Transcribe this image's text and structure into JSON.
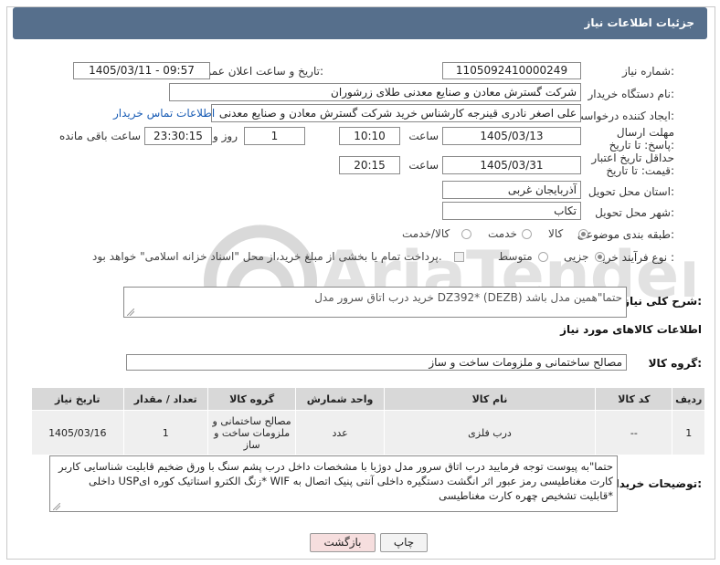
{
  "title": "جزئیات اطلاعات نیاز",
  "fields": {
    "need_number_label": "شماره نیاز:",
    "need_number": "1105092410000249",
    "announce_label": "تاریخ و ساعت اعلان عمومی:",
    "announce_value": "1405/03/11 - 09:57",
    "buyer_org_label": "نام دستگاه خریدار:",
    "buyer_org": "شرکت گسترش معادن و صنایع معدنی طلای زرشوران",
    "creator_label": "ایجاد کننده درخواست:",
    "creator": "علی اصغر نادری قینرجه کارشناس خرید  شرکت گسترش معادن و صنایع معدنی",
    "contact_link": "اطلاعات تماس خریدار",
    "reply_deadline_label": "مهلت ارسال پاسخ: تا تاریخ:",
    "reply_date": "1405/03/13",
    "time_label": "ساعت",
    "reply_time": "10:10",
    "days_value": "1",
    "day_and_label": "روز و",
    "remaining_time": "23:30:15",
    "remaining_label": "ساعت باقی مانده",
    "price_deadline_label": "حداقل تاریخ اعتبار قیمت: تا تاریخ:",
    "price_date": "1405/03/31",
    "price_time_label": "ساعت",
    "price_time": "20:15",
    "province_label": "استان محل تحویل:",
    "province": "آذربایجان غربی",
    "city_label": "شهر محل تحویل:",
    "city": "تکاب",
    "category_label": "طبقه بندی موضوعی:",
    "category_options": [
      "کالا",
      "خدمت",
      "کالا/خدمت"
    ],
    "process_label": "نوع فرآیند خرید :",
    "process_options": [
      "جزیی",
      "متوسط"
    ],
    "treasury_text": "پرداخت تمام یا بخشی از مبلغ خرید،از محل \"اسناد خزانه اسلامی\" خواهد بود.",
    "summary_label": "شرح کلی نیاز:",
    "summary": "خرید درب اتاق سرور مدل DZ392* (DEZB) حتما\"همین مدل باشد",
    "goods_info_title": "اطلاعات کالاهای مورد نیاز",
    "goods_group_label": "گروه کالا:",
    "goods_group": "مصالح ساختمانی و ملزومات ساخت و ساز",
    "buyer_notes_label": "توضیحات خریدار:",
    "buyer_notes": "حتما\"به پیوست توجه فرمایید درب اتاق سرور مدل دوژبا با مشخصات داخل درب پشم سنگ با ورق ضخیم قابلیت شناسایی کاربر کارت مغناطیسی رمز عبور اثر انگشت دستگیره داخلی آنتی پنیک اتصال به WIF *زنگ الکترو استاتیک کوره ایUSP داخلی *قابلیت تشخیص چهره کارت مغناطیسی"
  },
  "table": {
    "headers": [
      "ردیف",
      "کد کالا",
      "نام کالا",
      "واحد شمارش",
      "گروه کالا",
      "تعداد / مقدار",
      "تاریخ نیاز"
    ],
    "rows": [
      [
        "1",
        "--",
        "درب فلزی",
        "عدد",
        "مصالح ساختمانی و ملزومات ساخت و ساز",
        "1",
        "1405/03/16"
      ]
    ]
  },
  "buttons": {
    "print": "چاپ",
    "back": "بازگشت"
  },
  "colors": {
    "titlebar": "#566f8c",
    "link": "#1a5db5",
    "back_button": "#f6dede"
  }
}
